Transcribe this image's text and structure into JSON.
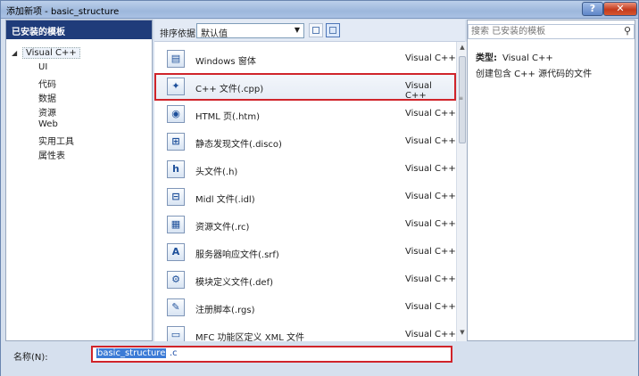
{
  "window": {
    "title": "添加新项 - basic_structure",
    "help_label": "?",
    "close_label": "✕"
  },
  "left_panel": {
    "header": "已安装的模板",
    "root": {
      "arrow": "◢",
      "label": "Visual C++"
    },
    "children": [
      "UI",
      "代码",
      "数据",
      "资源",
      "Web",
      "实用工具",
      "属性表"
    ]
  },
  "toolbar": {
    "sort_label": "排序依据:",
    "sort_value": "默认值"
  },
  "items": [
    {
      "icon": "form-icon",
      "glyph": "▤",
      "name": "Windows 窗体",
      "type": "Visual C++"
    },
    {
      "icon": "cpp-file-icon",
      "glyph": "✦",
      "name": "C++ 文件(.cpp)",
      "type": "Visual C++",
      "selected": true
    },
    {
      "icon": "html-page-icon",
      "glyph": "◉",
      "name": "HTML 页(.htm)",
      "type": "Visual C++"
    },
    {
      "icon": "disco-file-icon",
      "glyph": "⊞",
      "name": "静态发现文件(.disco)",
      "type": "Visual C++"
    },
    {
      "icon": "header-file-icon",
      "glyph": "h",
      "name": "头文件(.h)",
      "type": "Visual C++"
    },
    {
      "icon": "midl-file-icon",
      "glyph": "⊟",
      "name": "Midl 文件(.idl)",
      "type": "Visual C++"
    },
    {
      "icon": "resource-file-icon",
      "glyph": "▦",
      "name": "资源文件(.rc)",
      "type": "Visual C++"
    },
    {
      "icon": "srf-file-icon",
      "glyph": "A",
      "name": "服务器响应文件(.srf)",
      "type": "Visual C++"
    },
    {
      "icon": "def-file-icon",
      "glyph": "⚙",
      "name": "模块定义文件(.def)",
      "type": "Visual C++"
    },
    {
      "icon": "rgs-file-icon",
      "glyph": "✎",
      "name": "注册脚本(.rgs)",
      "type": "Visual C++"
    },
    {
      "icon": "mfc-xml-icon",
      "glyph": "▭",
      "name": "MFC 功能区定义 XML 文件",
      "type": "Visual C++"
    }
  ],
  "right_panel": {
    "search_placeholder": "搜索 已安装的模板",
    "type_label": "类型:",
    "type_value": "Visual C++",
    "description": "创建包含 C++ 源代码的文件"
  },
  "bottom": {
    "name_label": "名称(N):",
    "name_value_selected": "basic_structure",
    "name_value_rest": ".c"
  },
  "colors": {
    "accent": "#1f3c7a",
    "highlight_border": "#d0242a"
  }
}
